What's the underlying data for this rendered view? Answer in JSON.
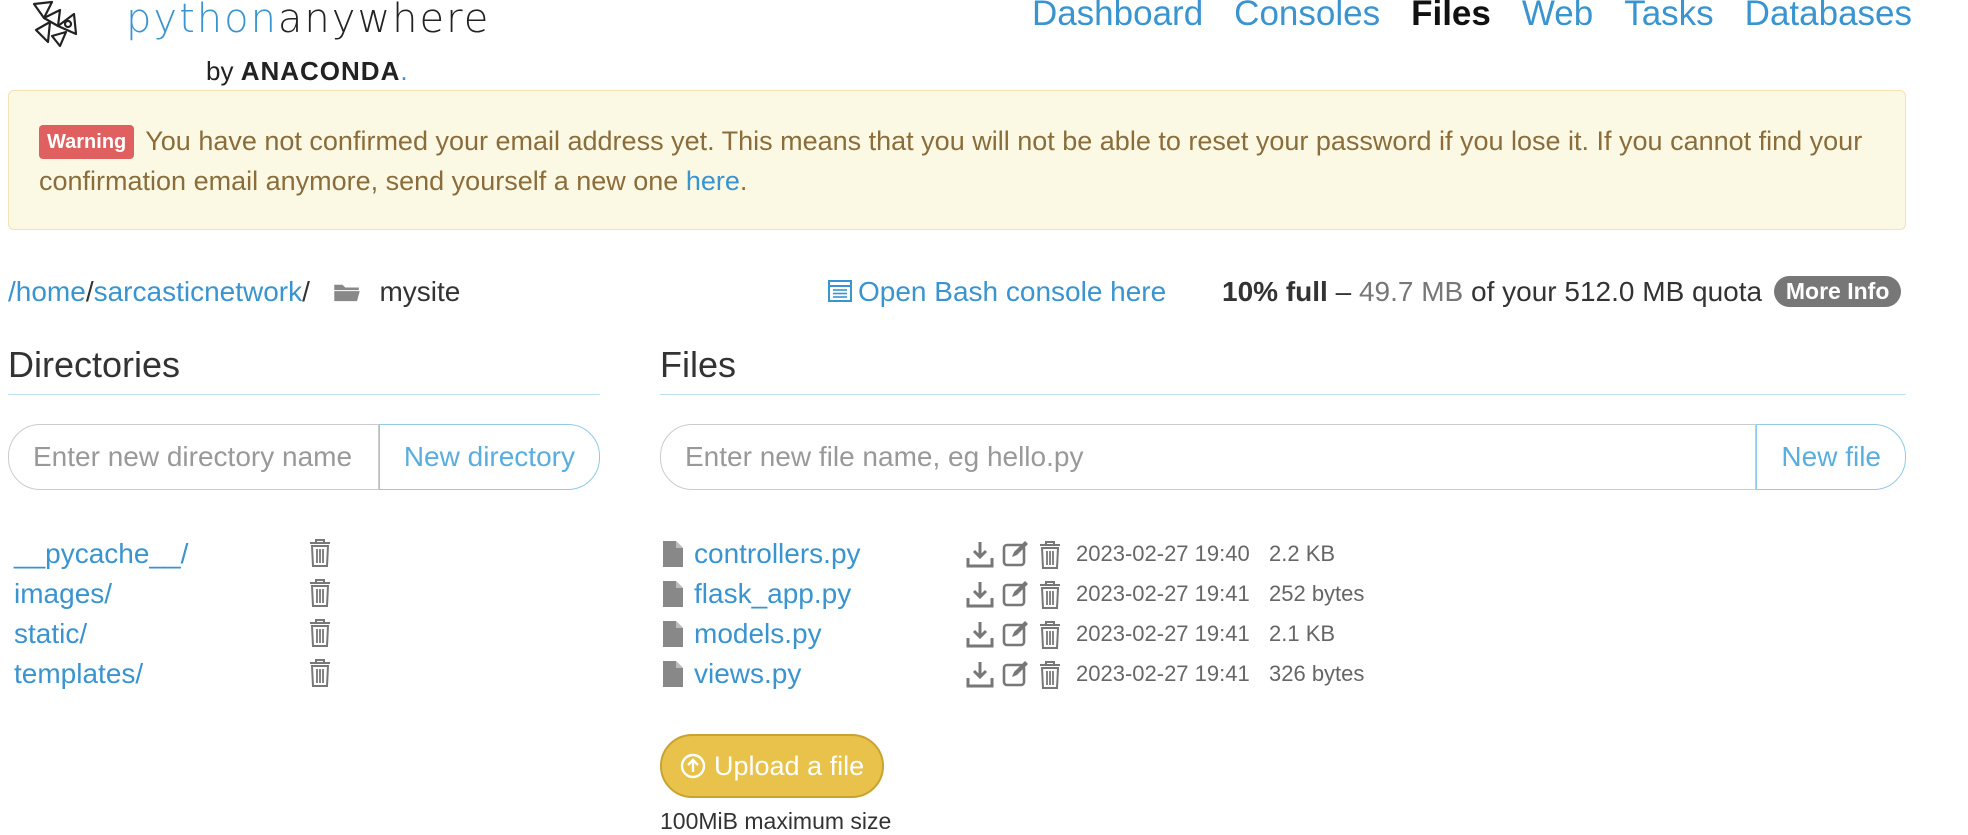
{
  "brand": {
    "name_light": "python",
    "name_dark": "anywhere",
    "by": "by",
    "company": "ANACONDA",
    "company_dot": "."
  },
  "nav": {
    "items": [
      {
        "label": "Dashboard",
        "active": false
      },
      {
        "label": "Consoles",
        "active": false
      },
      {
        "label": "Files",
        "active": true
      },
      {
        "label": "Web",
        "active": false
      },
      {
        "label": "Tasks",
        "active": false
      },
      {
        "label": "Databases",
        "active": false
      }
    ]
  },
  "warning": {
    "badge": "Warning",
    "text": "You have not confirmed your email address yet. This means that you will not be able to reset your password if you lose it. If you cannot find your confirmation email anymore, send yourself a new one",
    "link": "here",
    "end": "."
  },
  "path": {
    "segments": [
      "/home",
      "/",
      "sarcasticnetwork",
      "/"
    ],
    "current": "mysite"
  },
  "bash_link": "Open Bash console here",
  "quota": {
    "percent": "10% full",
    "dash": "–",
    "used": "49.7 MB",
    "rest": "of your 512.0 MB quota",
    "more_info": "More Info"
  },
  "directories": {
    "heading": "Directories",
    "placeholder": "Enter new directory name",
    "button": "New directory",
    "items": [
      "__pycache__/",
      "images/",
      "static/",
      "templates/"
    ]
  },
  "files": {
    "heading": "Files",
    "placeholder": "Enter new file name, eg hello.py",
    "button": "New file",
    "items": [
      {
        "name": "controllers.py",
        "date": "2023-02-27 19:40",
        "size": "2.2 KB"
      },
      {
        "name": "flask_app.py",
        "date": "2023-02-27 19:41",
        "size": "252 bytes"
      },
      {
        "name": "models.py",
        "date": "2023-02-27 19:41",
        "size": "2.1 KB"
      },
      {
        "name": "views.py",
        "date": "2023-02-27 19:41",
        "size": "326 bytes"
      }
    ]
  },
  "upload": {
    "label": "Upload a file",
    "note": "100MiB maximum size"
  },
  "colors": {
    "link": "#3a94cf",
    "warning_bg": "#fbf8e4",
    "warning_text": "#8a6d3b",
    "warning_badge": "#e06060",
    "upload_button": "#e8c24a"
  }
}
